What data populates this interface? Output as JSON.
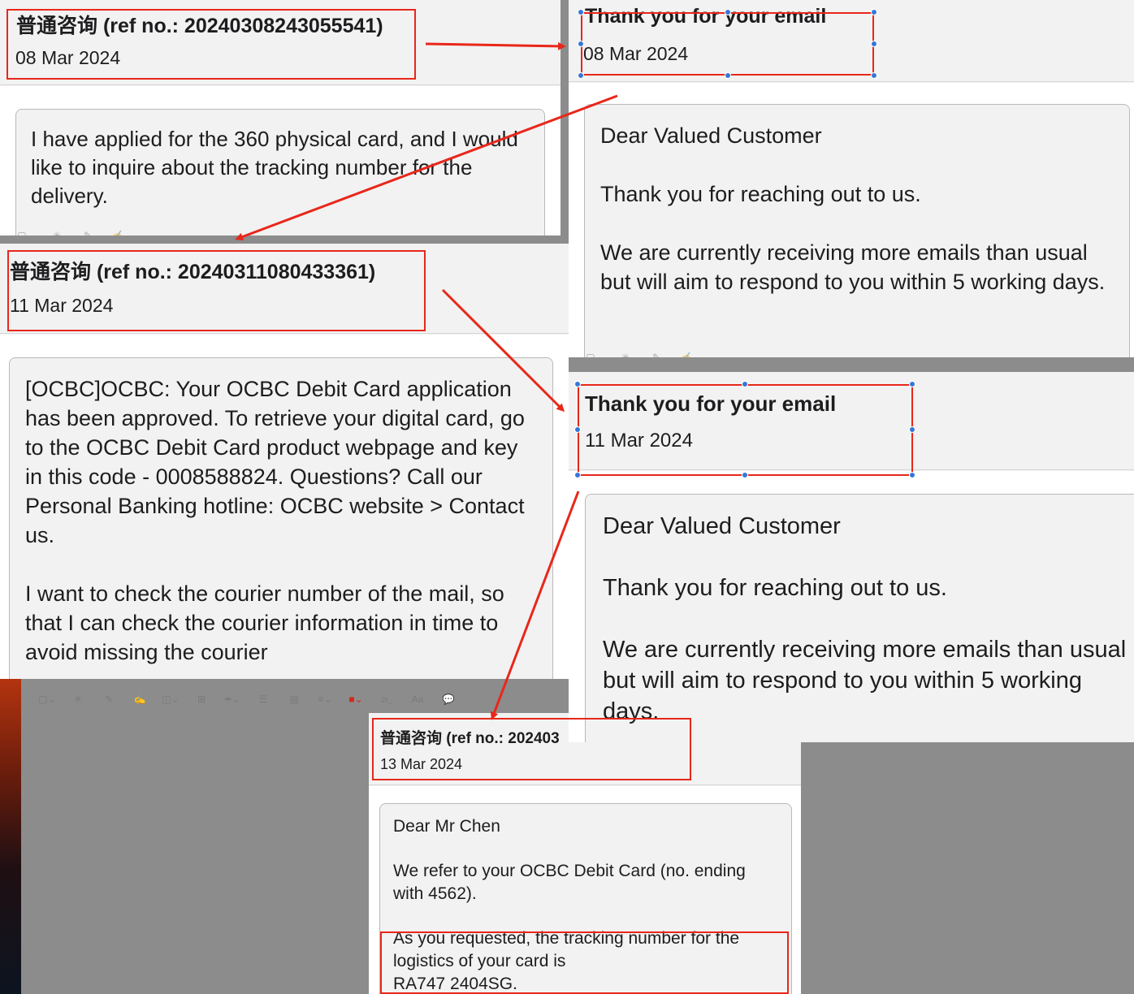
{
  "colors": {
    "annotation_red": "#e8271a",
    "handle_blue": "#3378d8"
  },
  "messages": {
    "enquiry_1": {
      "subject": "普通咨询 (ref no.: 20240308243055541)",
      "date": "08 Mar 2024",
      "body": "I have applied for the 360 physical card, and I would like to inquire about the tracking number for the delivery."
    },
    "reply_1": {
      "subject": "Thank you for your email",
      "date": "08 Mar 2024",
      "greeting": "Dear Valued Customer",
      "line1": "Thank you for reaching out to us.",
      "line2": "We are currently receiving more emails than usual but will aim to respond to you within 5 working days."
    },
    "enquiry_2": {
      "subject": "普通咨询 (ref no.: 20240311080433361)",
      "date": "11 Mar 2024",
      "para1": "[OCBC]OCBC: Your OCBC Debit Card application has been approved. To retrieve your digital card, go to the OCBC Debit Card product webpage and key in this code - 0008588824. Questions? Call our Personal Banking hotline: OCBC website > Contact us.",
      "para2": "I want to check the courier number of the mail, so that I can check the courier information in time to avoid missing the courier"
    },
    "reply_2": {
      "subject": "Thank you for your email",
      "date": "11 Mar 2024",
      "greeting": "Dear Valued Customer",
      "line1": "Thank you for reaching out to us.",
      "line2": "We are currently receiving more emails than usual but will aim to respond to you within 5 working days."
    },
    "reply_3": {
      "subject": "普通咨询 (ref no.: 202403",
      "date": "13 Mar 2024",
      "greeting": "Dear Mr Chen",
      "line1": "We refer to your OCBC Debit Card (no. ending with 4562).",
      "line2": "As you requested, the tracking number for the logistics of your card is",
      "tracking": "RA747   2404SG."
    }
  },
  "markup_toolbar": {
    "icons": [
      "selection-icon",
      "instant-alpha-icon",
      "sketch-icon",
      "draw-icon",
      "shapes-icon",
      "text-box-icon",
      "sign-icon",
      "adjust-color-icon",
      "page-layout-icon",
      "line-style-icon",
      "border-color-icon",
      "fill-color-icon",
      "font-style-icon",
      "description-icon"
    ],
    "font_label": "Aa"
  }
}
